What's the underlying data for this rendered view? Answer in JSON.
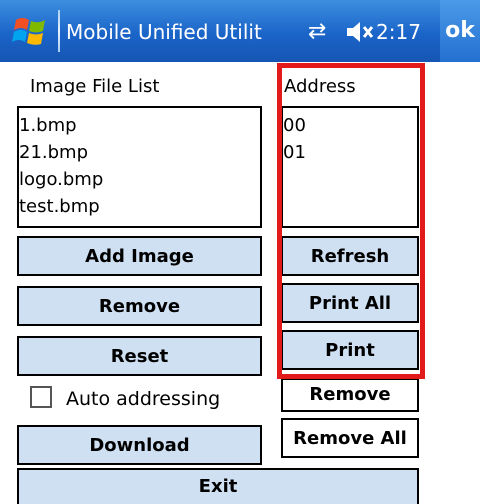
{
  "titlebar": {
    "title": "Mobile Unified Utilit",
    "clock": "2:17",
    "ok_label": "ok",
    "icons": [
      "windows-start-flag",
      "connectivity-arrows",
      "speaker-muted"
    ]
  },
  "left": {
    "list_label": "Image File List",
    "files": [
      "1.bmp",
      "21.bmp",
      "logo.bmp",
      "test.bmp"
    ],
    "add_image": "Add Image",
    "remove": "Remove",
    "reset": "Reset",
    "auto_addressing": "Auto addressing",
    "auto_addressing_checked": false,
    "download": "Download"
  },
  "right": {
    "list_label": "Address",
    "addresses": [
      "00",
      "01"
    ],
    "refresh": "Refresh",
    "print_all": "Print All",
    "print": "Print",
    "remove": "Remove",
    "remove_all": "Remove All"
  },
  "footer": {
    "exit": "Exit"
  },
  "colors": {
    "titlebar": "#1a64c8",
    "button_fill": "#cfe0f2",
    "highlight": "#e21a1a"
  }
}
